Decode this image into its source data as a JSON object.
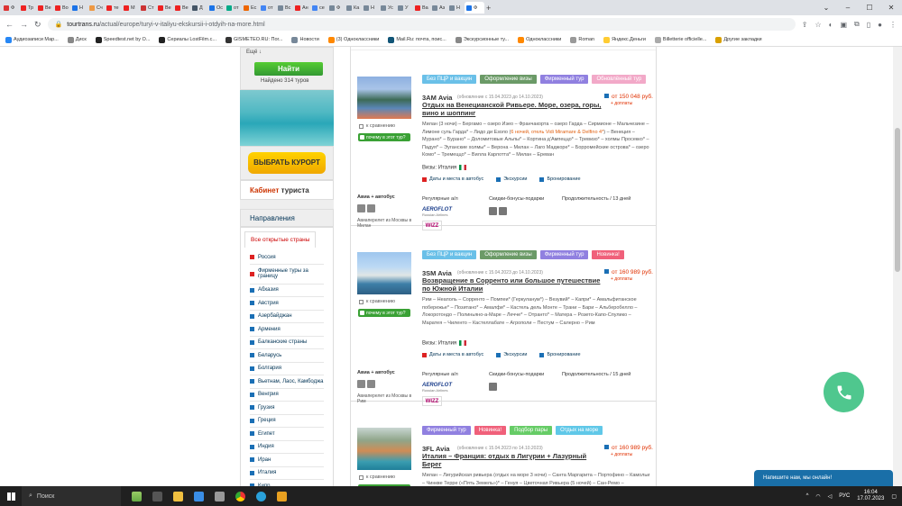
{
  "browser": {
    "tabs": [
      {
        "label": "Ф",
        "color": "#d33"
      },
      {
        "label": "Тр",
        "color": "#e22"
      },
      {
        "label": "Ве",
        "color": "#e22"
      },
      {
        "label": "Во",
        "color": "#e22"
      },
      {
        "label": "Н",
        "color": "#1a73e8"
      },
      {
        "label": "Сч",
        "color": "#e94"
      },
      {
        "label": "те",
        "color": "#e22"
      },
      {
        "label": "М",
        "color": "#e22"
      },
      {
        "label": "Ст",
        "color": "#c33"
      },
      {
        "label": "Ве",
        "color": "#e22"
      },
      {
        "label": "Ве",
        "color": "#e22"
      },
      {
        "label": "Д",
        "color": "#456"
      },
      {
        "label": "Ос",
        "color": "#1a73e8"
      },
      {
        "label": "от",
        "color": "#0a8"
      },
      {
        "label": "Ес",
        "color": "#e60"
      },
      {
        "label": "от",
        "color": "#4285f4"
      },
      {
        "label": "Вс",
        "color": "#789"
      },
      {
        "label": "Ан",
        "color": "#e22"
      },
      {
        "label": "се",
        "color": "#4285f4"
      },
      {
        "label": "Ф",
        "color": "#789"
      },
      {
        "label": "Ка",
        "color": "#789"
      },
      {
        "label": "Н",
        "color": "#789"
      },
      {
        "label": "Ус",
        "color": "#789"
      },
      {
        "label": "У",
        "color": "#789"
      },
      {
        "label": "Ва",
        "color": "#e22"
      },
      {
        "label": "Аз",
        "color": "#789"
      },
      {
        "label": "Н",
        "color": "#789"
      },
      {
        "label": "Ф",
        "color": "#1a73e8",
        "active": true
      }
    ],
    "url_host": "tourtrans.ru",
    "url_path": "/actual/europe/turyi-v-italiyu-ekskursii-i-otdyih-na-more.html",
    "bookmarks": [
      {
        "label": "Аудиозаписи Мар...",
        "color": "#2787f5"
      },
      {
        "label": "Диск",
        "color": "#888"
      },
      {
        "label": "Speedtest.net by O...",
        "color": "#222"
      },
      {
        "label": "Сериалы LostFilm.c...",
        "color": "#222"
      },
      {
        "label": "GISMETEO.RU: Пог...",
        "color": "#333"
      },
      {
        "label": "Новости",
        "color": "#789"
      },
      {
        "label": "(3) Одноклассники",
        "color": "#f80"
      },
      {
        "label": "Mail.Ru: почта, поис...",
        "color": "#157"
      },
      {
        "label": "Экскурсионные ту...",
        "color": "#888"
      },
      {
        "label": "Одноклассники",
        "color": "#f80"
      },
      {
        "label": "Roman",
        "color": "#999"
      },
      {
        "label": "Яндекс.Деньги",
        "color": "#fc3"
      },
      {
        "label": "Billetterie officielle...",
        "color": "#aaa"
      },
      {
        "label": "Другие закладки",
        "color": "#d9a000"
      }
    ]
  },
  "sidebar": {
    "esche": "Ещё ↓",
    "find_button": "Найти",
    "found": "Найдено 314 туров",
    "resort_button": "ВЫБРАТЬ КУРОРТ",
    "cabinet_red": "Кабинет",
    "cabinet_rest": " туриста",
    "directions": "Направления",
    "open_countries": "Все открытые страны",
    "countries": [
      {
        "label": "Россия",
        "red": true
      },
      {
        "label": "Фирменные туры за границу",
        "red": true
      },
      {
        "label": "Абхазия"
      },
      {
        "label": "Австрия"
      },
      {
        "label": "Азербайджан"
      },
      {
        "label": "Армения"
      },
      {
        "label": "Балканские страны"
      },
      {
        "label": "Беларусь"
      },
      {
        "label": "Болгария"
      },
      {
        "label": "Вьетнам, Лаос, Камбоджа"
      },
      {
        "label": "Венгрия"
      },
      {
        "label": "Грузия"
      },
      {
        "label": "Греция"
      },
      {
        "label": "Египет"
      },
      {
        "label": "Индия"
      },
      {
        "label": "Иран"
      },
      {
        "label": "Италия"
      },
      {
        "label": "Кипр"
      }
    ]
  },
  "tours": [
    {
      "badges": [
        {
          "label": "Без ПЦР и вакцин",
          "cls": "b-blue"
        },
        {
          "label": "Оформление визы",
          "cls": "b-green"
        },
        {
          "label": "Фирменный тур",
          "cls": "b-violet"
        },
        {
          "label": "Обновлённый тур",
          "cls": "b-pink"
        }
      ],
      "photo": "p1",
      "code": "3АМ Avia",
      "updated": "(обновление с 15.04.2023 до 14.10.2023)",
      "title": "Отдых на Венецианской Ривьере. Море, озера, горы, вино и шоппинг",
      "price": "от 150 048 руб.",
      "extra": "+ доплаты",
      "route_a": "Милан (3 ночи) – Бергамо – озеро Изео – Франчакорта – озеро Гарда – Сирмионе – Мальчезине – Лимоне суль Гарда* – Лидо ди Езоло (",
      "route_hl": "6 ночей, отель Vidi Miramare & Delfino 4*",
      "route_b": ") – Венеция – Мурано* – Бурано* – Доломитовые Альпы* – Кортина д'Ампеццо* – Тревизо* – холмы Просекко* – Падуя* – Эуганские холмы* – Верона – Милан – Лаго Маджоре* – Борромейские острова* – озеро Комо* – Тремеццо* – Вилла Карлотта* – Милан – Ереван",
      "visa": "Визы: Италия",
      "links": [
        "Даты и места в автобус",
        "Экскурсии",
        "Бронирование"
      ],
      "transport": "Авиа + автобус",
      "flights_from": "Авиаперелет из Москвы в Милан",
      "regular": "Регулярные а/л",
      "discounts": "Скидки-бонусы-подарки",
      "duration": "Продолжительность / 13 дней",
      "discount_icons": 2
    },
    {
      "badges": [
        {
          "label": "Без ПЦР и вакцин",
          "cls": "b-blue"
        },
        {
          "label": "Оформление визы",
          "cls": "b-green"
        },
        {
          "label": "Фирменный тур",
          "cls": "b-violet"
        },
        {
          "label": "Новинка!",
          "cls": "b-red"
        }
      ],
      "photo": "p2",
      "code": "3SM Avia",
      "updated": "(обновление с 15.04.2023 до 14.10.2023)",
      "title": "Возвращение в Сорренто или большое путешествие по Южной Италии",
      "price": "от 160 989 руб.",
      "extra": "+ доплаты",
      "route_a": "Рим – Неаполь – Сорренто – Помпеи* (Геркуланум*) – Везувий* – Капри* – Амальфитанское побережье* – Позитано* – Амалфи* – Кастель дель Монте – Трани – Бари – Альберобелло – Локоротондо – Полиньяно-а-Маре – Лечче* – Отранто* – Матера – Розето-Капо-Спулико – Маратея – Чиленто – Кастеллабате – Агрополи – Пестум – Салерно – Рим",
      "route_hl": "",
      "route_b": "",
      "visa": "Визы: Италия",
      "links": [
        "Даты и места в автобус",
        "Экскурсии",
        "Бронирование"
      ],
      "transport": "Авиа + автобус",
      "flights_from": "Авиаперелет из Москвы в Рим",
      "regular": "Регулярные а/л",
      "discounts": "Скидки-бонусы-подарки",
      "duration": "Продолжительность / 15 дней",
      "discount_icons": 1
    },
    {
      "badges": [
        {
          "label": "Фирменный тур",
          "cls": "b-violet"
        },
        {
          "label": "Новинка!",
          "cls": "b-red"
        },
        {
          "label": "Подбор пары",
          "cls": "b-lgreen"
        },
        {
          "label": "Отдых на море",
          "cls": "b-sky"
        }
      ],
      "photo": "p3",
      "code": "3FL Avia",
      "updated": "(обновление с 15.04.2023 по 14.10.2023)",
      "title": "Италия – Франция: отдых в Лигурии + Лазурный Берег",
      "price": "от 160 989 руб.",
      "extra": "+ доплаты",
      "route_a": "Милан – Лигурийская ривьера (отдых на море 3 ночи) – Санта Маргарита – Портофино – Камольи – Чинкве Терре («Пять Земель»)* – Генуя – Цветочная Ривьера (5 ночей) – Сан-Ремо –",
      "route_hl": "",
      "route_b": ""
    }
  ],
  "aeroflot": "AEROFLOT",
  "aeroflot_sub": "Russian Airlines",
  "wizz": "WIZZ",
  "compare": "к сравнению",
  "why": "почему в этот тур?",
  "chat": "Напишите нам, мы онлайн!",
  "taskbar": {
    "search": "Поиск",
    "lang": "РУС",
    "time": "16:04",
    "date": "17.07.2023"
  }
}
